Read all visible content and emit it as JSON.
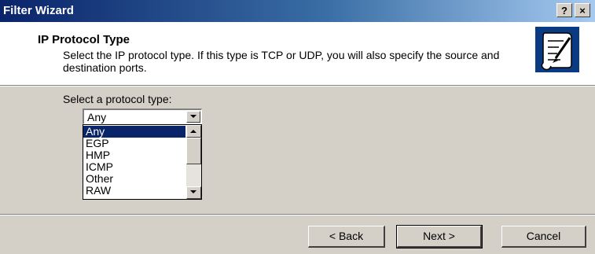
{
  "window": {
    "title": "Filter Wizard",
    "help_label": "?",
    "close_label": "×"
  },
  "header": {
    "title": "IP Protocol Type",
    "description": "Select the IP protocol type. If this type is TCP or UDP, you will also specify the source and destination ports."
  },
  "protocol": {
    "label": "Select a protocol type:",
    "selected": "Any",
    "options": [
      "Any",
      "EGP",
      "HMP",
      "ICMP",
      "Other",
      "RAW"
    ],
    "highlighted_index": 0
  },
  "buttons": {
    "back": "< Back",
    "next": "Next >",
    "cancel": "Cancel"
  },
  "colors": {
    "title_bar": "#0a246a",
    "dialog_face": "#d4d0c8",
    "selection": "#0a246a"
  },
  "icons": {
    "wizard": "document-pen-icon"
  }
}
